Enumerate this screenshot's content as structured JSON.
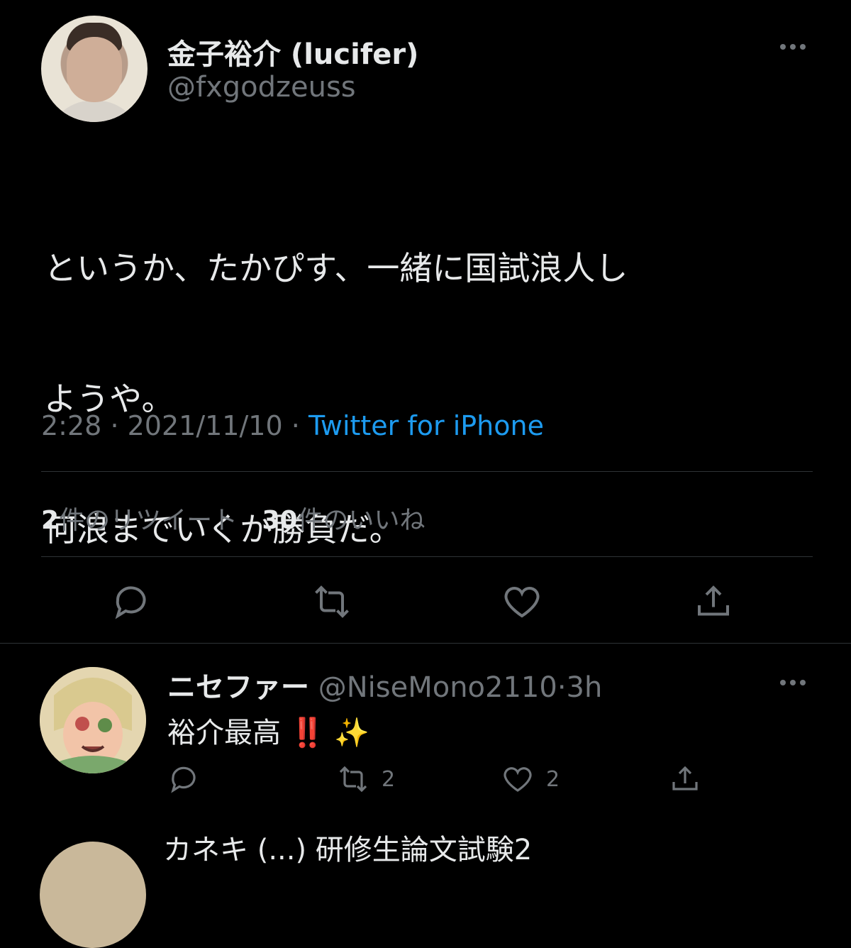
{
  "tweet": {
    "author_name": "金子裕介 (lucifer)",
    "author_handle": "@fxgodzeuss",
    "text_lines": [
      "というか、たかぴす、一緒に国試浪人し",
      "ようや。",
      "何浪までいくか勝負だ。"
    ],
    "time": "2:28",
    "separator": "·",
    "date": "2021/11/10",
    "source": "Twitter for iPhone",
    "retweet_count": "2",
    "retweet_label": "件のリツイート",
    "like_count": "30",
    "like_label": "件のいいね",
    "icons": [
      "reply-icon",
      "retweet-icon",
      "like-icon",
      "share-icon"
    ]
  },
  "reply": {
    "author_name": "ニセファー",
    "author_handle": "@NiseMono2110",
    "separator": "·",
    "time_ago": "3h",
    "text": "裕介最高",
    "emoji": "‼️ ✨",
    "retweet_count": "2",
    "like_count": "2"
  },
  "next_tweet_partial": "カネキ (...) 研修生論文試験2"
}
